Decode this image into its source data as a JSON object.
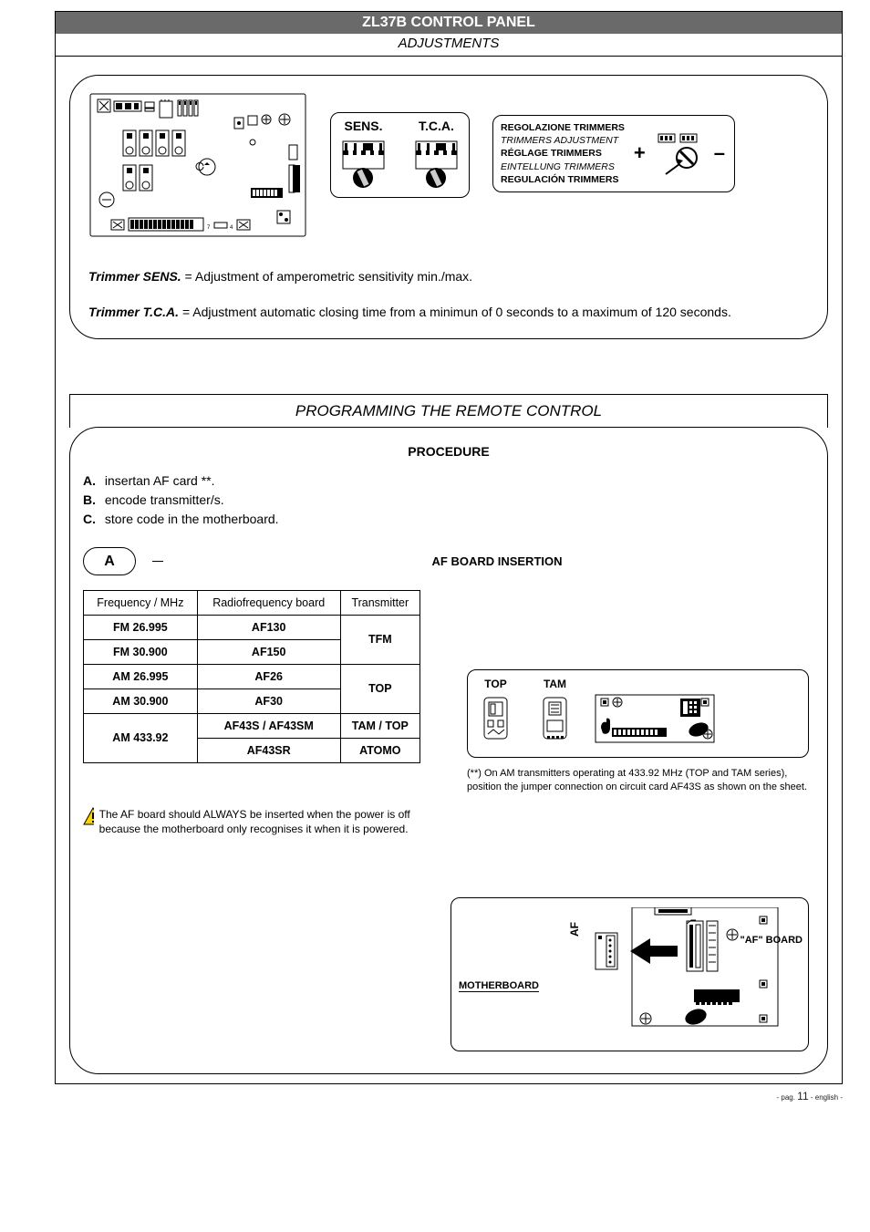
{
  "title": "ZL37B CONTROL PANEL",
  "subtitle": "ADJUSTMENTS",
  "trimmers": {
    "sens_label": "SENS.",
    "tca_label": "T.C.A."
  },
  "legend": {
    "line1": "REGOLAZIONE TRIMMERS",
    "line2": "TRIMMERS ADJUSTMENT",
    "line3": "RÉGLAGE TRIMMERS",
    "line4": "EINTELLUNG TRIMMERS",
    "line5": "REGULACIÓN TRIMMERS",
    "plus": "+",
    "minus": "–"
  },
  "descriptions": {
    "sens_label": "Trimmer SENS.",
    "sens_text": " = Adjustment of amperometric sensitivity min./max.",
    "tca_label": "Trimmer T.C.A.",
    "tca_text": " = Adjustment automatic closing time from a minimun of 0 seconds to a maximum of 120 seconds."
  },
  "remote": {
    "section_title": "PROGRAMMING THE REMOTE CONTROL",
    "procedure_title": "PROCEDURE",
    "step_a_label": "A.",
    "step_a_text": "insertan AF card **.",
    "step_b_label": "B.",
    "step_b_text": "encode transmitter/s.",
    "step_c_label": "C.",
    "step_c_text": "store code in the motherboard.",
    "oval_a": "A",
    "af_insertion_title": "AF BOARD INSERTION",
    "table": {
      "h1": "Frequency / MHz",
      "h2": "Radiofrequency board",
      "h3": "Transmitter",
      "rows": [
        {
          "f": "FM 26.995",
          "b": "AF130",
          "t": "TFM",
          "rs": 2
        },
        {
          "f": "FM 30.900",
          "b": "AF150",
          "t": ""
        },
        {
          "f": "AM 26.995",
          "b": "AF26",
          "t": "TOP",
          "rs": 2
        },
        {
          "f": "AM 30.900",
          "b": "AF30",
          "t": ""
        },
        {
          "f": "AM 433.92",
          "b": "AF43S / AF43SM",
          "t": "TAM / TOP",
          "rs": 1,
          "fspan": 2
        },
        {
          "f": "",
          "b": "AF43SR",
          "t": "ATOMO"
        }
      ]
    },
    "warn_text": "The AF board should ALWAYS be inserted when the power is off because the motherboard only recognises it when it is powered.",
    "top_label": "TOP",
    "tam_label": "TAM",
    "footnote": "(**) On AM transmitters operating at 433.92 MHz (TOP and TAM series), position the jumper connection on circuit card AF43S as shown on the sheet.",
    "mb_label": "MOTHERBOARD",
    "af_label_v": "AF",
    "af_board_label": "\"AF\" BOARD"
  },
  "footer": {
    "prefix": "- pag. ",
    "page": "11",
    "suffix": " - english -"
  }
}
